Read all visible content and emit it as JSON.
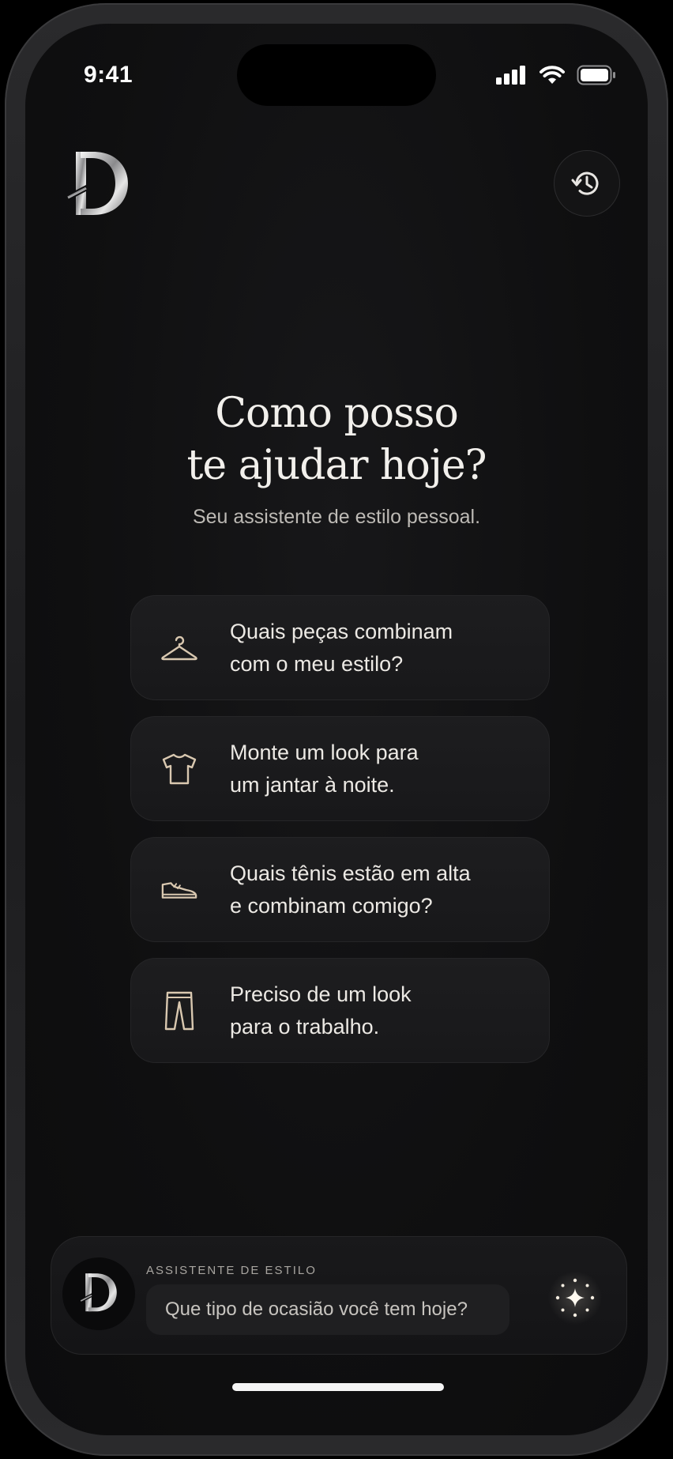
{
  "status_bar": {
    "time": "9:41"
  },
  "header": {
    "logo_icon": "d-monogram-icon",
    "history_icon": "history-icon"
  },
  "hero": {
    "title_line1": "Como posso",
    "title_line2": "te ajudar hoje?",
    "subtitle": "Seu assistente de estilo pessoal."
  },
  "suggestions": [
    {
      "icon": "hanger-icon",
      "text": "Quais peças combinam\ncom o meu estilo?"
    },
    {
      "icon": "tshirt-icon",
      "text": "Monte um look para\num jantar à noite."
    },
    {
      "icon": "sneaker-icon",
      "text": "Quais tênis estão em alta\ne combinam comigo?"
    },
    {
      "icon": "pants-icon",
      "text": "Preciso de um look\npara o trabalho."
    }
  ],
  "composer": {
    "label": "ASSISTENTE DE ESTILO",
    "placeholder": "Que tipo de ocasião você tem hoje?",
    "send_icon": "sparkle-icon"
  },
  "colors": {
    "background": "#0f0f10",
    "card": "#1b1b1d",
    "accent_icon": "#d9c8b0",
    "text_primary": "#f2f0ec"
  }
}
